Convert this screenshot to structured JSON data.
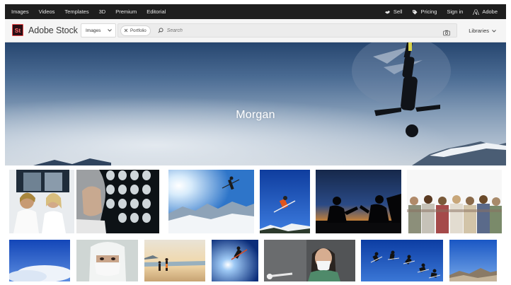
{
  "topnav": {
    "links": [
      "Images",
      "Videos",
      "Templates",
      "3D",
      "Premium",
      "Editorial"
    ],
    "sell": "Sell",
    "pricing": "Pricing",
    "sign_in": "Sign in",
    "adobe": "Adobe"
  },
  "searchbar": {
    "logo_badge": "St",
    "logo_text": "Adobe Stock",
    "asset_type": "Images",
    "chip_label": "Portfolio",
    "placeholder": "Search",
    "libraries": "Libraries"
  },
  "hero": {
    "title": "Morgan"
  },
  "colors": {
    "nav_bg": "#1e1e1e",
    "logo_red": "#ee4a4a",
    "sky_top": "#27466f",
    "sky_bottom": "#c7d0d9"
  },
  "icons": [
    "sell-icon",
    "pricing-tag-icon",
    "adobe-logo-icon",
    "chevron-down-icon",
    "close-icon",
    "search-icon",
    "camera-icon"
  ],
  "thumbnails": [
    "x-ray-doctors",
    "brain-scans-doctor",
    "skier-jump-sun",
    "skier-blue-sky",
    "silhouette-friends-sunset",
    "friends-group-hug",
    "clouds-blue-sky",
    "surgeon-mask",
    "beach-walkers",
    "skier-sunburst",
    "nurse-mask-syringe",
    "skier-sequence",
    "mountain-sky"
  ]
}
